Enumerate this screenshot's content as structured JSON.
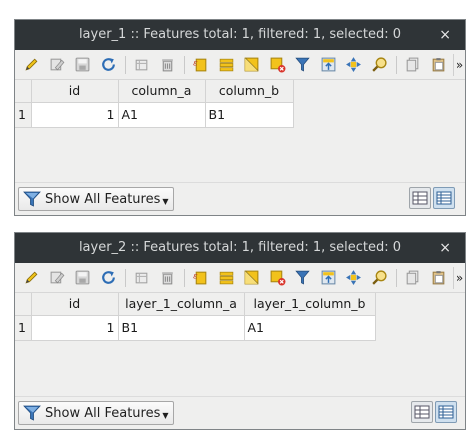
{
  "windows": [
    {
      "title": "layer_1 :: Features total: 1, filtered: 1, selected: 0",
      "close": "×",
      "columns": [
        "id",
        "column_a",
        "column_b"
      ],
      "rows": [
        {
          "header": "1",
          "cells": [
            "1",
            "A1",
            "B1"
          ]
        }
      ],
      "show_features_label": "Show All Features",
      "more": "»"
    },
    {
      "title": "layer_2 :: Features total: 1, filtered: 1, selected: 0",
      "close": "×",
      "columns": [
        "id",
        "layer_1_column_a",
        "layer_1_column_b"
      ],
      "rows": [
        {
          "header": "1",
          "cells": [
            "1",
            "B1",
            "A1"
          ]
        }
      ],
      "show_features_label": "Show All Features",
      "more": "»"
    }
  ],
  "toolbar_icons": [
    "edit-pencil-icon",
    "multi-edit-icon",
    "save-icon",
    "reload-icon",
    "add-feature-icon",
    "delete-icon",
    "select-by-expression-icon",
    "select-all-icon",
    "invert-selection-icon",
    "deselect-icon",
    "filter-icon",
    "move-selection-to-top-icon",
    "pan-to-selected-icon",
    "zoom-to-selected-icon",
    "copy-icon",
    "paste-icon"
  ],
  "colors": {
    "titlebar": "#2f3437",
    "window_bg": "#efefee",
    "accent_yellow": "#f2c21b",
    "accent_blue": "#3a74b7"
  }
}
